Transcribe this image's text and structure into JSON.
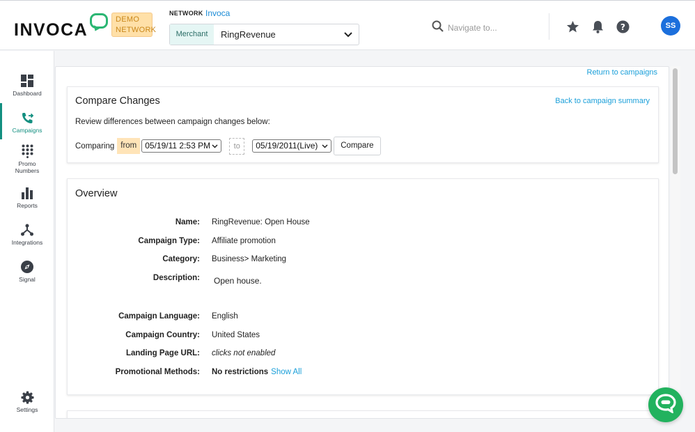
{
  "header": {
    "logo_text": "INVOCA",
    "demo_badge": [
      "DEMO",
      "NETWORK"
    ],
    "network_label": "NETWORK",
    "network_value": "Invoca",
    "merchant_tag": "Merchant",
    "merchant_value": "RingRevenue",
    "search_placeholder": "Navigate to...",
    "avatar_initials": "SS"
  },
  "sidebar": {
    "items": [
      {
        "label": "Dashboard",
        "icon": "dashboard-icon"
      },
      {
        "label": "Campaigns",
        "icon": "phone-arrow-icon",
        "active": true
      },
      {
        "label": "Promo Numbers",
        "icon": "keypad-icon"
      },
      {
        "label": "Reports",
        "icon": "bar-chart-icon"
      },
      {
        "label": "Integrations",
        "icon": "integrations-icon"
      },
      {
        "label": "Signal",
        "icon": "compass-icon"
      },
      {
        "label": "Settings",
        "icon": "gear-icon"
      }
    ]
  },
  "main": {
    "return_link": "Return to campaigns",
    "compare": {
      "title": "Compare Changes",
      "back_link": "Back to campaign summary",
      "description": "Review differences between campaign changes below:",
      "comparing_label": "Comparing",
      "from_label": "from",
      "from_value": "05/19/11 2:53 PM",
      "to_label": "to",
      "to_value": "05/19/2011(Live)",
      "compare_button": "Compare"
    },
    "overview": {
      "title": "Overview",
      "fields": [
        {
          "label": "Name:",
          "value": "RingRevenue: Open House"
        },
        {
          "label": "Campaign Type:",
          "value": "Affiliate promotion"
        },
        {
          "label": "Category:",
          "value": "Business> Marketing"
        },
        {
          "label": "Description:",
          "value": "Open house."
        },
        {
          "label": "Campaign Language:",
          "value": "English"
        },
        {
          "label": "Campaign Country:",
          "value": "United States"
        },
        {
          "label": "Landing Page URL:",
          "value": "clicks not enabled"
        },
        {
          "label": "Promotional Methods:",
          "value": "No restrictions",
          "link": "Show All"
        }
      ]
    }
  },
  "colors": {
    "accent_teal": "#138f80",
    "link_blue": "#1a9fd9",
    "avatar_blue": "#1c6fdc",
    "chat_green": "#22b25e",
    "logo_green": "#2bb673"
  }
}
